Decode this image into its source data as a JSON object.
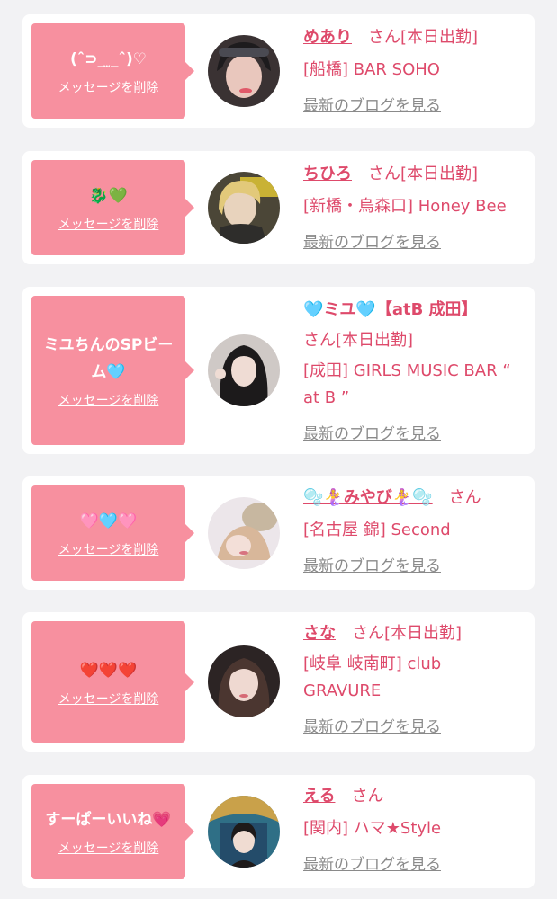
{
  "delete_label": "メッセージを削除",
  "blog_label": "最新のブログを見る",
  "san_label": "さん",
  "cards": [
    {
      "message": "(ˆ⊃_ ̫_ˆ)♡",
      "name": "めあり",
      "status": "[本日出勤]",
      "shop": "[船橋] BAR SOHO"
    },
    {
      "message": "🐉💚",
      "name": "ちひろ",
      "status": "[本日出勤]",
      "shop": "[新橋・烏森口] Honey Bee"
    },
    {
      "message": "ミユちんのSPビーム🩵",
      "name": "🩵ミユ🩵【atB 成田】",
      "status": "[本日出勤]",
      "shop": "[成田] GIRLS MUSIC BAR “ at B ”"
    },
    {
      "message": "🩷🩵🩷",
      "name": "🫧🧜‍♀️みやび🧜‍♀️🫧",
      "status": "",
      "shop": "[名古屋 錦] Second"
    },
    {
      "message": "❤️❤️❤️",
      "name": "さな",
      "status": "[本日出勤]",
      "shop": "[岐阜 岐南町] club GRAVURE"
    },
    {
      "message": "すーぱーいいね💗",
      "name": "える",
      "status": "",
      "shop": "[関内] ハマ★Style"
    }
  ]
}
